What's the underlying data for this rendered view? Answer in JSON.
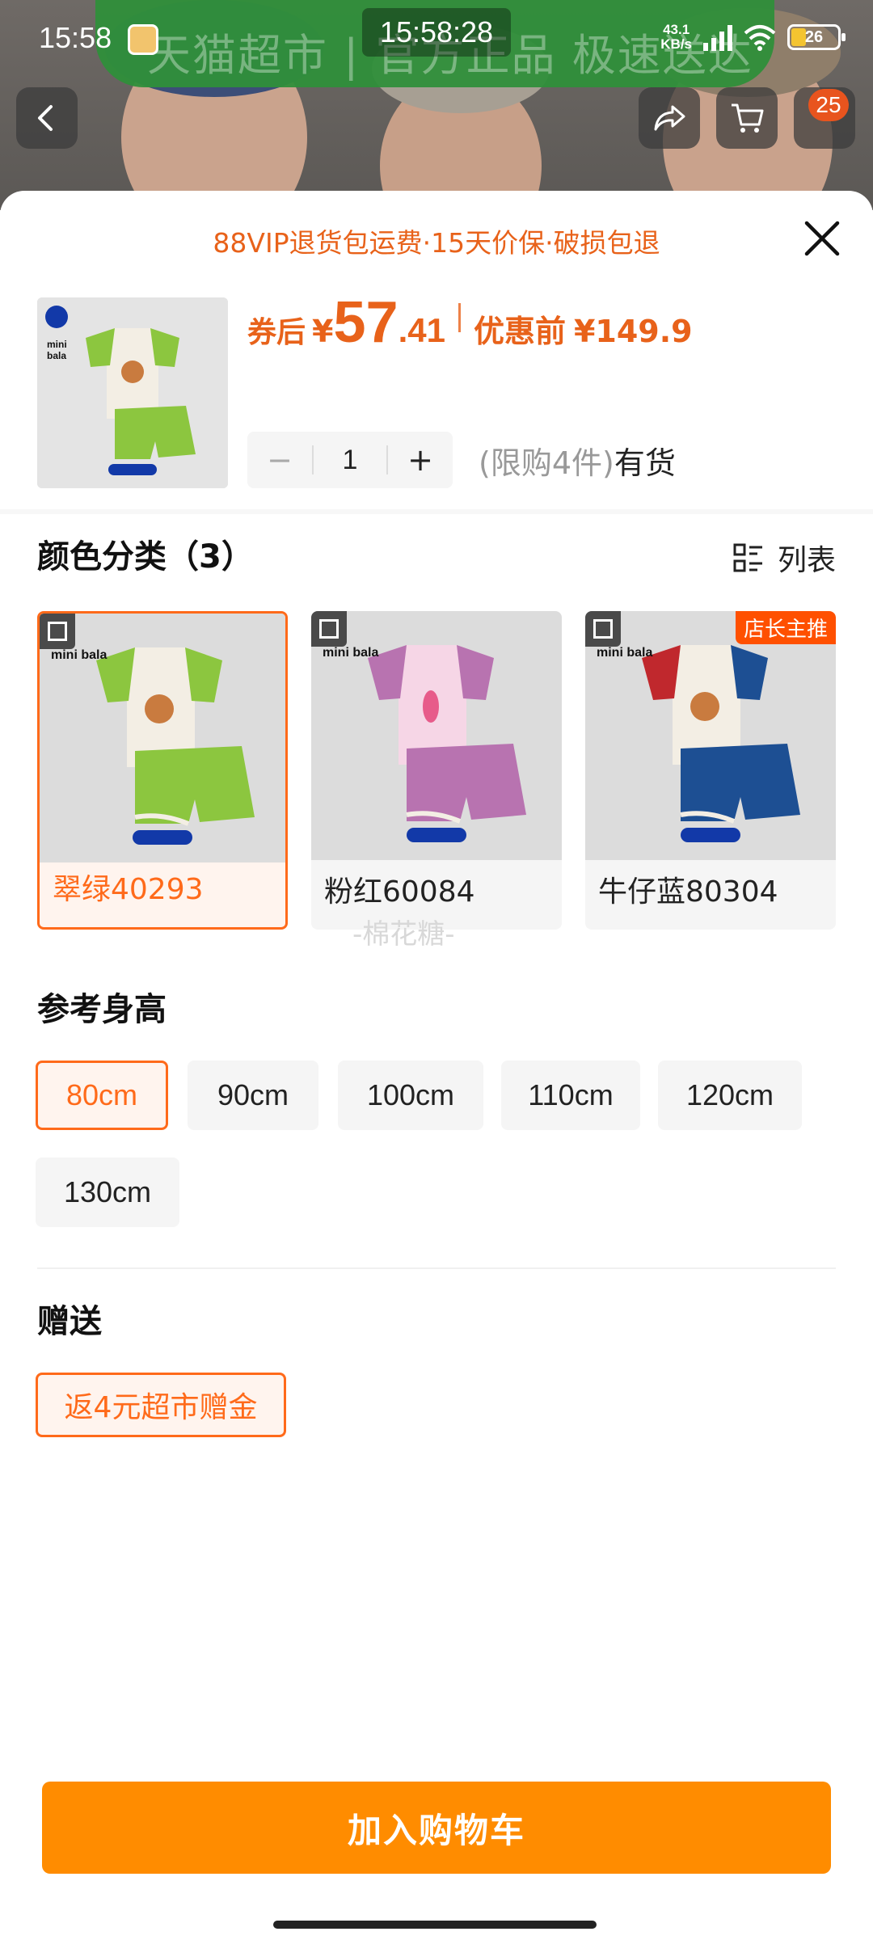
{
  "status_bar": {
    "time": "15:58",
    "clock": "15:58:28",
    "net_speed_value": "43.1",
    "net_speed_unit": "KB/s",
    "battery": "26"
  },
  "background": {
    "banner_text": "天猫超市 | 官方正品 极速送达",
    "cart_badge": "25"
  },
  "sheet": {
    "promo": "88VIP退货包运费·15天价保·破损包退",
    "price": {
      "label": "券后",
      "currency": "¥",
      "integer": "57",
      "decimal": ".41",
      "original_label": "优惠前",
      "original": "¥149.9"
    },
    "quantity": {
      "minus": "−",
      "value": "1",
      "plus": "+",
      "limit": "(限购4件)",
      "stock": "有货"
    },
    "color_section": {
      "title": "颜色分类（3）",
      "view_toggle": "列表",
      "options": [
        {
          "label": "翠绿40293",
          "selected": true,
          "tag": "",
          "brand": "mini bala",
          "top_color": "#f3eee4",
          "sleeve_color": "#8cc63f",
          "shorts_color": "#8cc63f"
        },
        {
          "label": "粉红60084",
          "selected": false,
          "tag": "",
          "brand": "mini bala",
          "top_color": "#f6d6e6",
          "sleeve_color": "#b873b0",
          "shorts_color": "#b873b0"
        },
        {
          "label": "牛仔蓝80304",
          "selected": false,
          "tag": "店长主推",
          "brand": "mini bala",
          "top_color": "#f3eee4",
          "sleeve_color": "#c0282d",
          "shorts_color": "#1d4f93"
        }
      ]
    },
    "watermark": "-棉花糖-",
    "size_section": {
      "title": "参考身高",
      "options": [
        "80cm",
        "90cm",
        "100cm",
        "110cm",
        "120cm",
        "130cm"
      ],
      "selected": "80cm"
    },
    "gift_section": {
      "title": "赠送",
      "option": "返4元超市赠金"
    },
    "add_to_cart": "加入购物车"
  },
  "colors": {
    "accent": "#ff6a1a",
    "price": "#e8621a",
    "button": "#ff8c00",
    "chip_bg": "#f5f5f5"
  }
}
